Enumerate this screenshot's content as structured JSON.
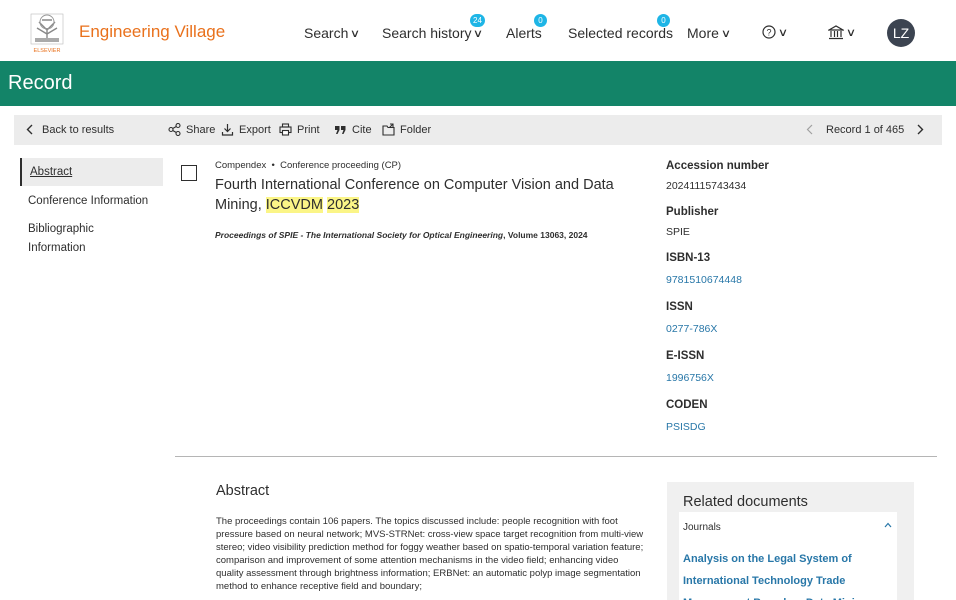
{
  "nav": {
    "brand": "Engineering Village",
    "logo_text": "ELSEVIER",
    "items": [
      {
        "label": "Search",
        "badge": null
      },
      {
        "label": "Search history",
        "badge": "24"
      },
      {
        "label": "Alerts",
        "badge": "0"
      },
      {
        "label": "Selected records",
        "badge": "0"
      },
      {
        "label": "More",
        "badge": null
      }
    ],
    "avatar_initials": "LZ"
  },
  "page": {
    "title": "Record"
  },
  "toolbar": {
    "back_label": "Back to results",
    "share_label": "Share",
    "export_label": "Export",
    "print_label": "Print",
    "cite_label": "Cite",
    "folder_label": "Folder",
    "record_counter": "Record 1 of 465"
  },
  "side_nav": {
    "items": [
      "Abstract",
      "Conference Information",
      "Bibliographic Information"
    ]
  },
  "record": {
    "database": "Compendex",
    "separator": "•",
    "doc_type": "Conference proceeding (CP)",
    "title_part1": "Fourth International Conference on Computer Vision and Data Mining, ",
    "title_hl1": "ICCVDM",
    "title_hl2": "2023",
    "source_journal": "Proceedings of SPIE - The International Society for Optical Engineering",
    "source_rest": ", Volume 13063, 2024"
  },
  "meta": {
    "accession_label": "Accession number",
    "accession_value": "20241115743434",
    "publisher_label": "Publisher",
    "publisher_value": "SPIE",
    "isbn_label": "ISBN-13",
    "isbn_value": "9781510674448",
    "issn_label": "ISSN",
    "issn_value": "0277-786X",
    "eissn_label": "E-ISSN",
    "eissn_value": "1996756X",
    "coden_label": "CODEN",
    "coden_value": "PSISDG"
  },
  "abstract": {
    "heading": "Abstract",
    "text": "The proceedings contain 106 papers. The topics discussed include: people recognition with foot pressure based on neural network; MVS-STRNet: cross-view space target recognition from multi-view stereo; video visibility prediction method for foggy weather based on spatio-temporal variation feature; comparison and improvement of some attention mechanisms in the video field; enhancing video quality assessment through brightness information; ERBNet: an automatic polyp image segmentation method to enhance receptive field and boundary;"
  },
  "related": {
    "heading": "Related documents",
    "category": "Journals",
    "link_text": "Analysis on the Legal System of International Technology Trade Management Based on Data Mining"
  },
  "colors": {
    "accent_orange": "#e9711c",
    "band_green": "#138468",
    "badge_blue": "#1eb5e6",
    "link_blue": "#2877a8",
    "highlight": "#fbf587"
  }
}
